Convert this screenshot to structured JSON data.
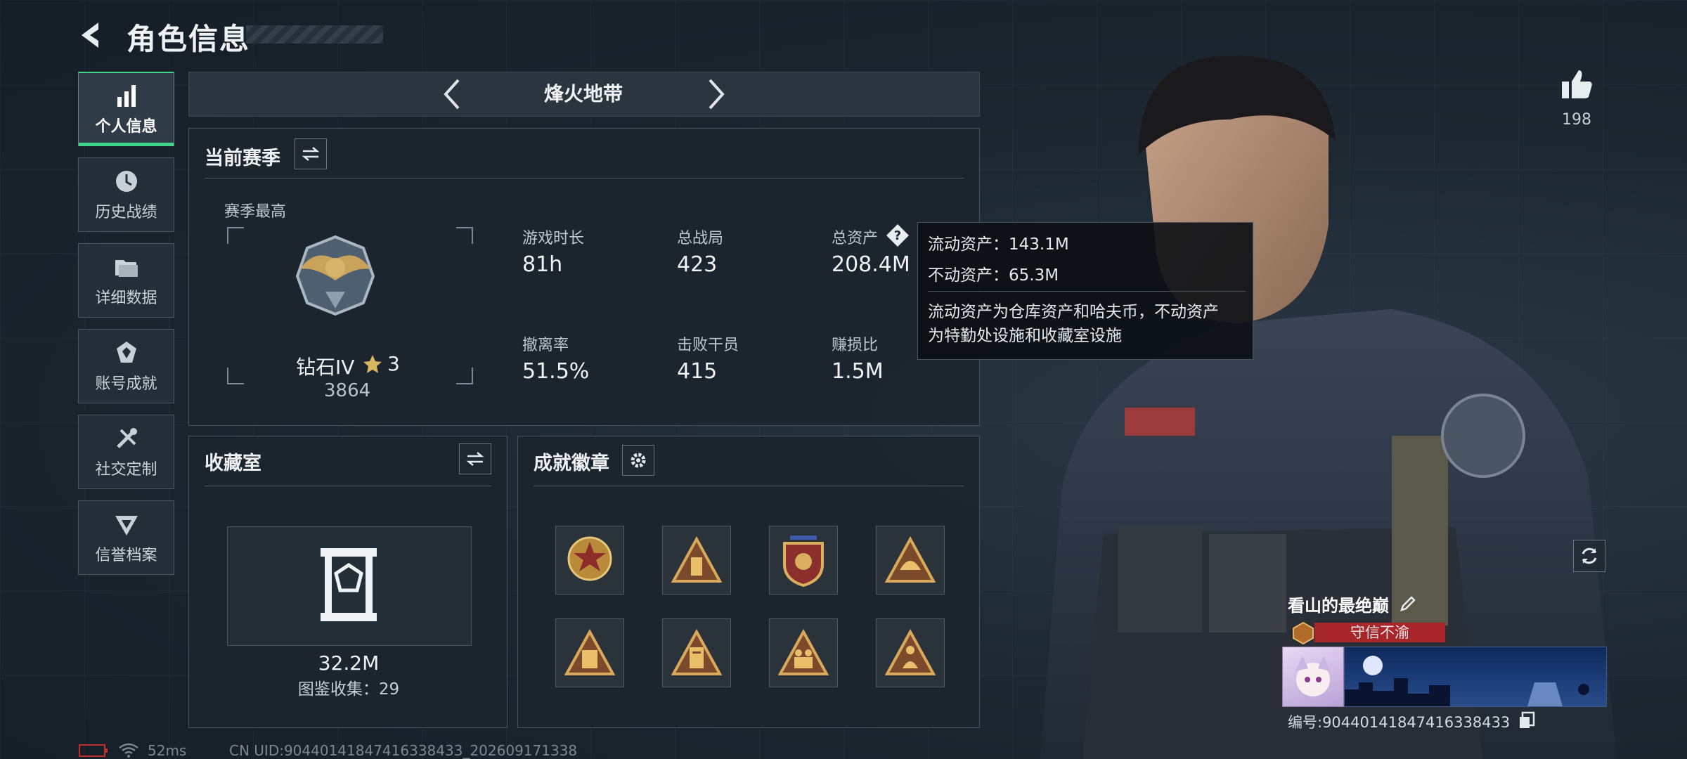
{
  "header": {
    "title": "角色信息"
  },
  "sidebar": {
    "items": [
      {
        "label": "个人信息",
        "icon": "bar-chart-icon",
        "active": true
      },
      {
        "label": "历史战绩",
        "icon": "history-clock-icon"
      },
      {
        "label": "详细数据",
        "icon": "folder-icon"
      },
      {
        "label": "账号成就",
        "icon": "achievement-icon"
      },
      {
        "label": "社交定制",
        "icon": "tools-icon"
      },
      {
        "label": "信誉档案",
        "icon": "credit-emblem-icon"
      }
    ]
  },
  "mode": {
    "title": "烽火地带"
  },
  "season": {
    "title": "当前赛季",
    "best_label": "赛季最高",
    "rank_name": "钻石IV",
    "rank_stars": "3",
    "rank_score": "3864",
    "stats": [
      {
        "label": "游戏时长",
        "value": "81h"
      },
      {
        "label": "总战局",
        "value": "423"
      },
      {
        "label": "总资产",
        "value": "208.4M"
      },
      {
        "label": "撤离率",
        "value": "51.5%"
      },
      {
        "label": "击败干员",
        "value": "415"
      },
      {
        "label": "赚损比",
        "value": "1.5M"
      }
    ]
  },
  "tooltip": {
    "liquid": "流动资产：143.1M",
    "fixed": "不动资产：65.3M",
    "desc_line1": "流动资产为仓库资产和哈夫币，不动资产",
    "desc_line2": "为特勤处设施和收藏室设施"
  },
  "collection": {
    "title": "收藏室",
    "value": "32.2M",
    "count": "图鉴收集：29"
  },
  "achievements": {
    "title": "成就徽章",
    "badges": [
      "badge-star-shield",
      "badge-triangle-tower",
      "badge-eagle-shield",
      "badge-triangle-hat",
      "badge-triangle-55",
      "badge-triangle-doc",
      "badge-triangle-soldiers",
      "badge-triangle-figure"
    ]
  },
  "like": {
    "count": "198"
  },
  "player": {
    "name": "看山的最绝巅",
    "title": "守信不渝",
    "id_label": "编号:90440141847416338433"
  },
  "status_bar": {
    "ping": "52ms",
    "uid": "CN UID:90440141847416338433_202609171338"
  },
  "colors": {
    "accent_green": "#3fd38a",
    "title_red": "#a8262a"
  }
}
